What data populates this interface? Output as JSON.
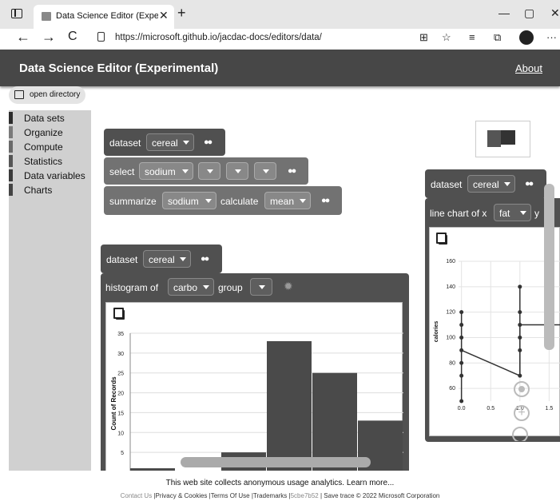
{
  "browser": {
    "tab_title": "Data Science Editor (Experimenta",
    "tab_close": "✕",
    "new_tab": "+",
    "minimize": "—",
    "maximize": "▢",
    "close": "✕",
    "url": "https://microsoft.github.io/jacdac-docs/editors/data/",
    "back": "←",
    "forward": "→",
    "reload": "C",
    "menu": "···"
  },
  "app": {
    "title": "Data Science Editor (Experimental)",
    "about": "About",
    "open_directory": "open directory"
  },
  "sidebar": {
    "items": [
      {
        "label": "Data sets",
        "color": "#2c2c2c"
      },
      {
        "label": "Organize",
        "color": "#7a7a7a"
      },
      {
        "label": "Compute",
        "color": "#6a6a6a"
      },
      {
        "label": "Statistics",
        "color": "#555555"
      },
      {
        "label": "Data variables",
        "color": "#3a3a3a"
      },
      {
        "label": "Charts",
        "color": "#444444"
      }
    ]
  },
  "blocks1": {
    "dataset_label": "dataset",
    "dataset_value": "cereal",
    "select_label": "select",
    "select_value": "sodium",
    "summarize_label": "summarize",
    "summarize_value": "sodium",
    "calculate_label": "calculate",
    "calculate_value": "mean"
  },
  "blocks2": {
    "dataset_label": "dataset",
    "dataset_value": "cereal",
    "histogram_label": "histogram of",
    "histogram_value": "carbo",
    "group_label": "group"
  },
  "blocks3": {
    "dataset_label": "dataset",
    "dataset_value": "cereal",
    "line_label": "line chart of x",
    "line_value": "fat",
    "y_label": "y"
  },
  "histogram_chart": {
    "type": "bar",
    "ylabel": "Count of Records",
    "ylim": [
      0,
      35
    ],
    "yticks": [
      "35",
      "30",
      "25",
      "20",
      "15",
      "10",
      "5"
    ],
    "values": [
      1,
      0,
      5,
      33,
      25,
      13
    ],
    "bar_color": "#4a4a4a"
  },
  "line_chart": {
    "type": "line",
    "ylabel": "calories",
    "yticks": [
      "160",
      "140",
      "120",
      "100",
      "80",
      "60"
    ],
    "xticks": [
      "0.0",
      "0.5",
      "1.0",
      "1.5"
    ],
    "ylim": [
      50,
      160
    ],
    "xlim": [
      -0.05,
      1.7
    ],
    "points_x0": [
      50,
      70,
      80,
      90,
      100,
      110,
      120
    ],
    "points_x1": [
      70,
      90,
      100,
      110,
      120,
      140
    ],
    "line": [
      [
        0,
        90
      ],
      [
        1,
        70
      ],
      [
        1,
        110
      ],
      [
        1.7,
        110
      ]
    ]
  },
  "footer": {
    "analytics": "This web site collects anonymous usage analytics. Learn more...",
    "contact": "Contact Us",
    "privacy": "|Privacy & Cookies |Terms Of Use |Trademarks |",
    "hash": "5cbe7b52",
    "tail": "| Save trace © 2022 Microsoft Corporation"
  }
}
